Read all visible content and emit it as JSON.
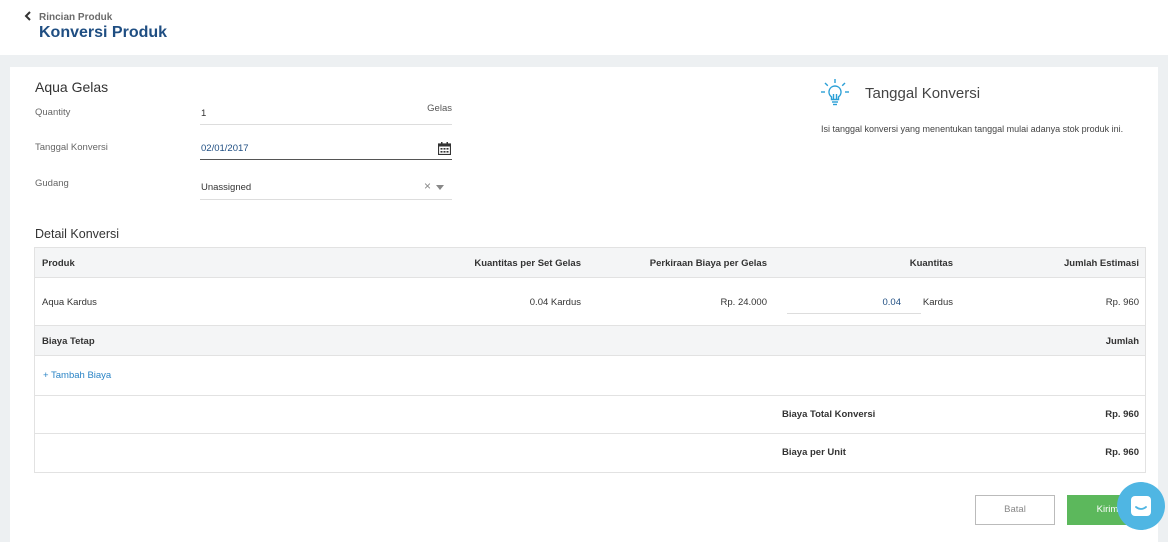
{
  "header": {
    "breadcrumb": "Rincian Produk",
    "title": "Konversi Produk"
  },
  "form": {
    "product_name": "Aqua Gelas",
    "quantity": {
      "label": "Quantity",
      "value": "1",
      "unit": "Gelas"
    },
    "date": {
      "label": "Tanggal Konversi",
      "value": "02/01/2017"
    },
    "warehouse": {
      "label": "Gudang",
      "value": "Unassigned",
      "clear": "×"
    }
  },
  "tip": {
    "title": "Tanggal Konversi",
    "text": "Isi tanggal konversi yang menentukan tanggal mulai adanya stok produk ini."
  },
  "detail": {
    "title": "Detail Konversi",
    "headers": [
      "Produk",
      "Kuantitas per Set Gelas",
      "Perkiraan Biaya per Gelas",
      "Kuantitas",
      "Jumlah Estimasi"
    ],
    "rows": [
      {
        "product": "Aqua Kardus",
        "qty_per_set": "0.04 Kardus",
        "cost": "Rp. 24.000",
        "qty": "0.04",
        "unit": "Kardus",
        "total": "Rp. 960"
      }
    ]
  },
  "fixed_cost": {
    "header_left": "Biaya Tetap",
    "header_right": "Jumlah",
    "add_link": "+ Tambah Biaya"
  },
  "summary": {
    "total_label": "Biaya Total Konversi",
    "total_value": "Rp. 960",
    "unit_label": "Biaya per Unit",
    "unit_value": "Rp. 960"
  },
  "actions": {
    "cancel": "Batal",
    "send": "Kirim"
  },
  "colors": {
    "title": "#1f4e82",
    "link": "#2a84c6",
    "primary_button": "#5cb85c",
    "chat_bubble": "#4fb6e3"
  }
}
